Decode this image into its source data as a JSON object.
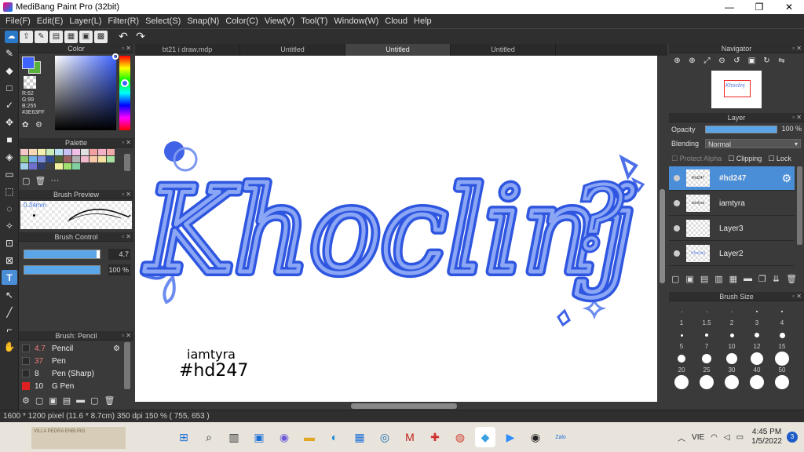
{
  "window": {
    "title": "MediBang Paint Pro (32bit)",
    "minimize": "—",
    "maximize": "❐",
    "close": "✕"
  },
  "menu": [
    "File(F)",
    "Edit(E)",
    "Layer(L)",
    "Filter(R)",
    "Select(S)",
    "Snap(N)",
    "Color(C)",
    "View(V)",
    "Tool(T)",
    "Window(W)",
    "Cloud",
    "Help"
  ],
  "toolbar": {
    "undo": "↶",
    "redo": "↷"
  },
  "tabs": [
    {
      "label": "bt21 i draw.mdp",
      "active": false
    },
    {
      "label": "Untitled",
      "active": false
    },
    {
      "label": "Untitled",
      "active": true
    },
    {
      "label": "Untitled",
      "active": false
    }
  ],
  "color_panel": {
    "title": "Color",
    "foreground": "#3E63FF",
    "rgb": [
      "R:62",
      "G:99",
      "B:255",
      "#3E63FF"
    ]
  },
  "palette_panel": {
    "title": "Palette",
    "more": "···",
    "colors": [
      "#f4c7c7",
      "#f6d9b4",
      "#f4f0b0",
      "#c8ecb8",
      "#b8e0f0",
      "#c8c0f0",
      "#f0c0e8",
      "#e0e0e0",
      "#f0a0a0",
      "#f4b0c4",
      "#f0a8a8",
      "#90c870",
      "#70b0e8",
      "#8090e0",
      "#304a90",
      "#506030",
      "#9d6060",
      "#b0b0b0",
      "#f0b8c8",
      "#f8c8a8",
      "#f4e0a0",
      "#a8e0a0",
      "#a0d0e8",
      "#7070d0",
      "#304070",
      "#404040",
      "#f0f0a0",
      "#a0e070",
      "#80d0a0"
    ]
  },
  "brush_preview": {
    "title": "Brush Preview",
    "size": "0.34mm"
  },
  "brush_control": {
    "title": "Brush Control",
    "size_value": "4.7",
    "opacity_value": "100 %",
    "size_fraction": 0.96,
    "opacity_fraction": 1.0
  },
  "brush_list": {
    "title": "Brush: Pencil",
    "items": [
      {
        "size": "4.7",
        "name": "Pencil",
        "selected": true,
        "swatch": "#2a2a2a"
      },
      {
        "size": "37",
        "name": "Pen",
        "selected": false,
        "swatch": "#2a2a2a"
      },
      {
        "size": "8",
        "name": "Pen (Sharp)",
        "selected": false,
        "swatch": "#2a2a2a"
      },
      {
        "size": "10",
        "name": "G Pen",
        "selected": false,
        "swatch": "#e02020"
      }
    ]
  },
  "canvas": {
    "main_text": "Khoclinj",
    "question": "?",
    "sign_name": "iamtyra",
    "sign_tag": "#hd247",
    "stroke_color": "#5b7fe6",
    "outline_color": "#2f56e0"
  },
  "status": "1600 * 1200 pixel   (11.6 * 8.7cm)   350 dpi   150 %   ( 755, 653 )",
  "navigator": {
    "title": "Navigator",
    "thumb_text": "Khoclinj"
  },
  "layer_panel": {
    "title": "Layer",
    "opacity_label": "Opacity",
    "opacity_value": "100 %",
    "blending_label": "Blending",
    "blending_value": "Normal",
    "protect_alpha": "Protect Alpha",
    "clipping": "Clipping",
    "lock": "Lock",
    "layers": [
      {
        "name": "#hd247",
        "thumb": "#hd247",
        "selected": true
      },
      {
        "name": "iamtyra",
        "thumb": "iamtyra",
        "selected": false
      },
      {
        "name": "Layer3",
        "thumb": "",
        "selected": false
      },
      {
        "name": "Layer2",
        "thumb": "Khoclinj",
        "selected": false
      }
    ]
  },
  "brush_size": {
    "title": "Brush Size",
    "sizes": [
      {
        "label": "1",
        "dot": 1
      },
      {
        "label": "1.5",
        "dot": 1
      },
      {
        "label": "2",
        "dot": 1
      },
      {
        "label": "3",
        "dot": 2
      },
      {
        "label": "4",
        "dot": 2
      },
      {
        "label": "5",
        "dot": 3
      },
      {
        "label": "7",
        "dot": 4
      },
      {
        "label": "10",
        "dot": 5
      },
      {
        "label": "12",
        "dot": 6
      },
      {
        "label": "15",
        "dot": 7
      },
      {
        "label": "20",
        "dot": 10
      },
      {
        "label": "25",
        "dot": 12
      },
      {
        "label": "30",
        "dot": 14
      },
      {
        "label": "40",
        "dot": 16
      },
      {
        "label": "50",
        "dot": 18
      },
      {
        "label": "",
        "dot": 18
      },
      {
        "label": "",
        "dot": 18
      },
      {
        "label": "",
        "dot": 18
      },
      {
        "label": "",
        "dot": 18
      },
      {
        "label": "",
        "dot": 18
      }
    ]
  },
  "taskbar": {
    "wallpaper_text": "VILLA PEDRA ENBURG",
    "lang": "VIE",
    "time": "4:45 PM",
    "date": "1/5/2022",
    "notifications": "3",
    "zalo": "Zalo"
  }
}
